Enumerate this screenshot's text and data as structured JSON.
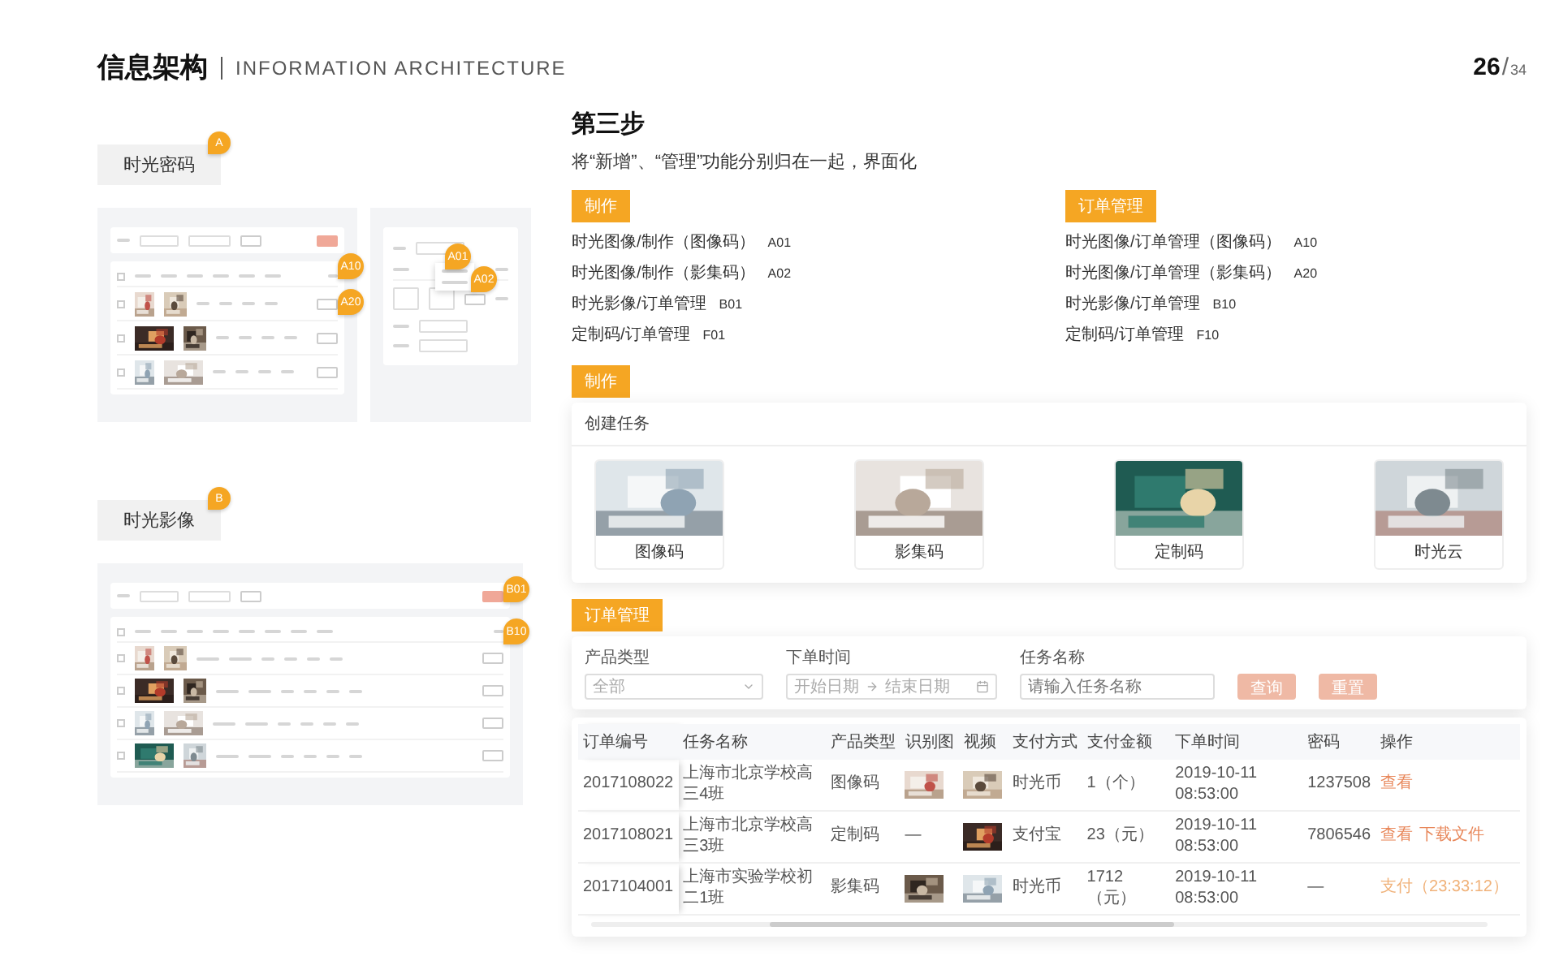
{
  "header": {
    "title": "信息架构",
    "subtitle": "INFORMATION ARCHITECTURE",
    "page": "26",
    "separator": "/",
    "total": "34"
  },
  "sections": [
    {
      "pin": "A",
      "label": "时光密码",
      "table_pins": [
        "A10",
        "A20"
      ],
      "form_pins": [
        "A01",
        "A02"
      ]
    },
    {
      "pin": "B",
      "label": "时光影像",
      "table_pins": [
        "B01",
        "B10"
      ]
    }
  ],
  "step": {
    "title": "第三步",
    "description": "将“新增”、“管理”功能分别归在一起，界面化"
  },
  "groups": [
    {
      "tag": "制作",
      "items": [
        {
          "path": "时光图像/制作（图像码）",
          "code": "A01"
        },
        {
          "path": "时光图像/制作（影集码）",
          "code": "A02"
        },
        {
          "path": "时光影像/订单管理",
          "code": "B01"
        },
        {
          "path": "定制码/订单管理",
          "code": "F01"
        }
      ]
    },
    {
      "tag": "订单管理",
      "items": [
        {
          "path": "时光图像/订单管理（图像码）",
          "code": "A10"
        },
        {
          "path": "时光图像/订单管理（影集码）",
          "code": "A20"
        },
        {
          "path": "时光影像/订单管理",
          "code": "B10"
        },
        {
          "path": "定制码/订单管理",
          "code": "F10"
        }
      ]
    }
  ],
  "create": {
    "tag": "制作",
    "title": "创建任务",
    "tiles": [
      {
        "label": "图像码"
      },
      {
        "label": "影集码"
      },
      {
        "label": "定制码"
      },
      {
        "label": "时光云"
      }
    ]
  },
  "orders": {
    "tag": "订单管理",
    "filters": [
      {
        "kind": "select",
        "label": "产品类型",
        "value": "全部"
      },
      {
        "kind": "range",
        "label": "下单时间",
        "start": "开始日期",
        "end": "结束日期"
      },
      {
        "kind": "text",
        "label": "任务名称",
        "placeholder": "请输入任务名称"
      }
    ],
    "buttons": [
      "查询",
      "重置"
    ],
    "columns": [
      "订单编号",
      "任务名称",
      "产品类型",
      "识别图",
      "视频",
      "支付方式",
      "支付金额",
      "下单时间",
      "密码",
      "操作"
    ],
    "rows": [
      {
        "cells": [
          {
            "kind": "text",
            "text": "2017108022"
          },
          {
            "kind": "text",
            "text": "上海市北京学校高三4班"
          },
          {
            "kind": "text",
            "text": "图像码"
          },
          {
            "kind": "picture"
          },
          {
            "kind": "picture"
          },
          {
            "kind": "text",
            "text": "时光币"
          },
          {
            "kind": "text",
            "text": "1（个）"
          },
          {
            "kind": "text",
            "text": "2019-10-11 08:53:00"
          },
          {
            "kind": "text",
            "text": "1237508"
          }
        ],
        "actions": [
          {
            "label": "查看",
            "pending": false
          }
        ]
      },
      {
        "cells": [
          {
            "kind": "text",
            "text": "2017108021"
          },
          {
            "kind": "text",
            "text": "上海市北京学校高三3班"
          },
          {
            "kind": "text",
            "text": "定制码"
          },
          {
            "kind": "text",
            "text": "—"
          },
          {
            "kind": "picture"
          },
          {
            "kind": "text",
            "text": "支付宝"
          },
          {
            "kind": "text",
            "text": "23（元）"
          },
          {
            "kind": "text",
            "text": "2019-10-11 08:53:00"
          },
          {
            "kind": "text",
            "text": "7806546"
          }
        ],
        "actions": [
          {
            "label": "查看",
            "pending": false
          },
          {
            "label": "下载文件",
            "pending": false
          }
        ]
      },
      {
        "cells": [
          {
            "kind": "text",
            "text": "2017104001"
          },
          {
            "kind": "text",
            "text": "上海市实验学校初二1班"
          },
          {
            "kind": "text",
            "text": "影集码"
          },
          {
            "kind": "picture"
          },
          {
            "kind": "picture"
          },
          {
            "kind": "text",
            "text": "时光币"
          },
          {
            "kind": "text",
            "text": "1712（元）"
          },
          {
            "kind": "text",
            "text": "2019-10-11 08:53:00"
          },
          {
            "kind": "text",
            "text": "—"
          }
        ],
        "actions": [
          {
            "label": "支付（23:33:12）",
            "pending": true
          }
        ]
      }
    ]
  }
}
